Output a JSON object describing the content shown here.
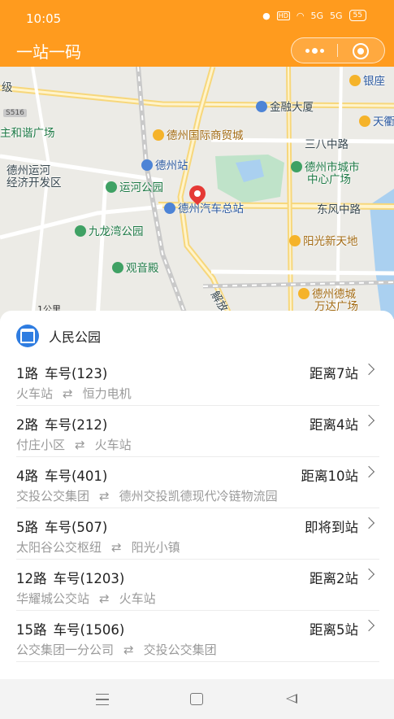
{
  "status_bar": {
    "time": "10:05",
    "hd": "HD",
    "sig1": "5G",
    "sig2": "5G",
    "battery": "55"
  },
  "app": {
    "title": "一站一码"
  },
  "map": {
    "labels": {
      "yinzuo": "银座",
      "tianqu": "天衢",
      "jiayin": "级",
      "road_s516": "S516",
      "hexie": "主和谐广场",
      "jinrong": "金融大厦",
      "guoji": "德州国际商贸城",
      "sanba": "三八中路",
      "dezhou_station": "德州站",
      "shizhongxin1": "德州市城市",
      "shizhongxin2": "中心广场",
      "yunhe_kf1": "德州运河",
      "yunhe_kf2": "经济开发区",
      "yunhe_park": "运河公园",
      "bus_terminal": "德州汽车总站",
      "dongfeng": "东风中路",
      "jiulongwan": "九龙湾公园",
      "yangguang": "阳光新天地",
      "guanyin": "观音殿",
      "jiefang": "解放",
      "decheng1": "德州德城",
      "decheng2": "万达广场"
    },
    "scale_label": "1公里"
  },
  "stop": {
    "name": "人民公园"
  },
  "routes": [
    {
      "line": "1路",
      "bus_no": "车号(123)",
      "distance": "距离7站",
      "from": "火车站",
      "arrow": "⇄",
      "to": "恒力电机"
    },
    {
      "line": "2路",
      "bus_no": "车号(212)",
      "distance": "距离4站",
      "from": "付庄小区",
      "arrow": "⇄",
      "to": "火车站"
    },
    {
      "line": "4路",
      "bus_no": "车号(401)",
      "distance": "距离10站",
      "from": "交投公交集团",
      "arrow": "⇄",
      "to": "德州交投凯德现代冷链物流园"
    },
    {
      "line": "5路",
      "bus_no": "车号(507)",
      "distance": "即将到站",
      "from": "太阳谷公交枢纽",
      "arrow": "⇄",
      "to": "阳光小镇"
    },
    {
      "line": "12路",
      "bus_no": "车号(1203)",
      "distance": "距离2站",
      "from": "华耀城公交站",
      "arrow": "⇄",
      "to": "火车站"
    },
    {
      "line": "15路",
      "bus_no": "车号(1506)",
      "distance": "距离5站",
      "from": "公交集团一分公司",
      "arrow": "⇄",
      "to": "交投公交集团"
    }
  ],
  "colors": {
    "brand": "#ff9b1e",
    "stop_icon": "#2f7de1",
    "pin": "#e53935"
  },
  "icons": [
    "location-icon",
    "wifi-icon",
    "signal-icon",
    "battery-icon",
    "more-icon",
    "close-target-icon",
    "bus-stop-icon",
    "chevron-right-icon",
    "map-pin-icon",
    "menu-icon",
    "home-icon",
    "back-icon"
  ]
}
